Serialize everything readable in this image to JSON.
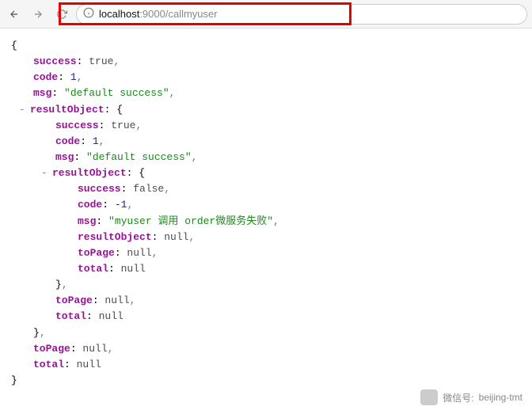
{
  "url": {
    "host": "localhost",
    "port": ":9000",
    "path": "/callmyuser"
  },
  "footer": {
    "label": "微信号:",
    "value": "beijing-tmt"
  },
  "response": {
    "success": "true",
    "code": "1",
    "msg": "\"default success\"",
    "resultObject": {
      "success": "true",
      "code": "1",
      "msg": "\"default success\"",
      "resultObject": {
        "success": "false",
        "code": "-1",
        "msg": "\"myuser 调用 order微服务失败\"",
        "resultObject": "null",
        "toPage": "null",
        "total": "null"
      },
      "toPage": "null",
      "total": "null"
    },
    "toPage": "null",
    "total": "null"
  },
  "labels": {
    "success": "success",
    "code": "code",
    "msg": "msg",
    "resultObject": "resultObject",
    "toPage": "toPage",
    "total": "total"
  }
}
